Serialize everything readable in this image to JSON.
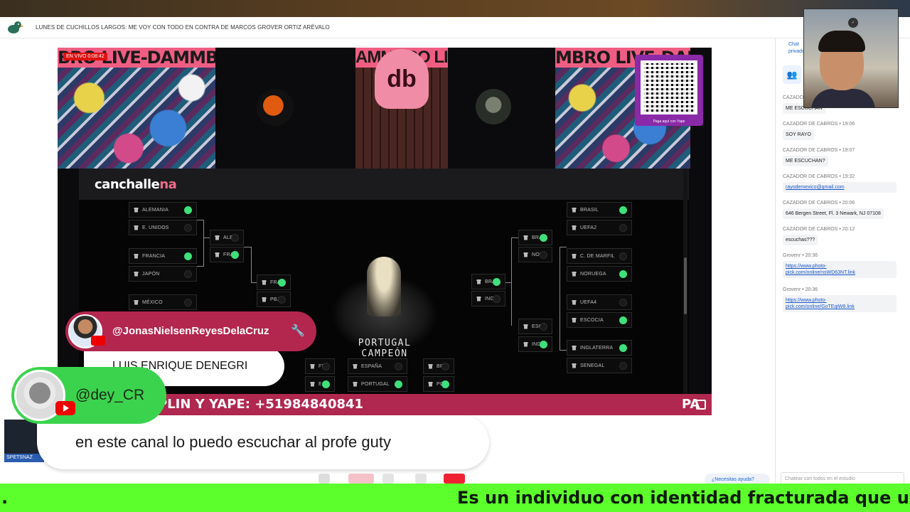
{
  "header": {
    "title": "LUNES DE CUCHILLOS LARGOS: ME VOY CON TODO EN CONTRA DE MARCOS GROVER ORTIZ ARÉVALO"
  },
  "stage": {
    "live_label": "EN VIVO 0:08:42",
    "banner_text": "BRO LIVE-DAMMBRO LIVE",
    "db_logo": "db",
    "banner_right": "MBRO LIVE-DAMMBRO LIVE-",
    "qr_caption": "Paga aquí con Yape",
    "brand_a": "canchalle",
    "brand_b": "na",
    "champion": "PORTUGAL CAMPEÓN",
    "ticker_left": "M, PLIN Y YAPE: +51984840841",
    "ticker_right": "PA"
  },
  "bracket": {
    "left_r1": [
      {
        "name": "ALEMANIA",
        "win": true
      },
      {
        "name": "E. UNIDOS",
        "win": false
      },
      {
        "name": "FRANCIA",
        "win": true
      },
      {
        "name": "JAPÓN",
        "win": false
      },
      {
        "name": "MÉXICO",
        "win": false
      }
    ],
    "left_r2": [
      {
        "name": "ALE",
        "win": false
      },
      {
        "name": "FRA",
        "win": true
      }
    ],
    "left_r3": [
      {
        "name": "FRA",
        "win": true
      },
      {
        "name": "PBJ",
        "win": false
      }
    ],
    "right_r1": [
      {
        "name": "BRASIL",
        "win": true
      },
      {
        "name": "UEFA2",
        "win": false
      },
      {
        "name": "C. DE MARFIL",
        "win": false
      },
      {
        "name": "NORUEGA",
        "win": true
      },
      {
        "name": "UEFA4",
        "win": false
      },
      {
        "name": "ESCOCIA",
        "win": true
      },
      {
        "name": "INGLATERRA",
        "win": true
      },
      {
        "name": "SENEGAL",
        "win": false
      }
    ],
    "right_r2": [
      {
        "name": "BRA",
        "win": true
      },
      {
        "name": "NOR",
        "win": false
      },
      {
        "name": "ESC",
        "win": false
      },
      {
        "name": "ING",
        "win": true
      }
    ],
    "right_r3": [
      {
        "name": "BRA",
        "win": true
      },
      {
        "name": "ING",
        "win": false
      }
    ],
    "bottom": [
      {
        "name": "FRA",
        "win": false
      },
      {
        "name": "ESP",
        "win": true
      },
      {
        "name": "ESPAÑA",
        "win": false
      },
      {
        "name": "PORTUGAL",
        "win": true
      },
      {
        "name": "BRA",
        "win": false
      },
      {
        "name": "POR",
        "win": true
      }
    ]
  },
  "overlay": {
    "comment1_user": "@JonasNielsenReyesDelaCruz",
    "comment1_text": "LUIS ENRIQUE DENEGRI",
    "comment2_user": "@dey_CR",
    "comment2_text": "en este canal lo puedo escuchar al profe guty"
  },
  "side_thumb": {
    "label": "SPETSNAZ"
  },
  "chat": {
    "tab_label": "Chat privado",
    "messages": [
      {
        "meta": "CAZADOR DE CABROS",
        "text": "ME ESCUCHAN",
        "link": false
      },
      {
        "meta": "CAZADOR DE CABROS • 19:06",
        "text": "SOY RAYO",
        "link": false
      },
      {
        "meta": "CAZADOR DE CABROS • 19:07",
        "text": "ME ESCUCHAN?",
        "link": false
      },
      {
        "meta": "CAZADOR DE CABROS • 19:32",
        "text": "rayodemexico@gmail.com",
        "link": true
      },
      {
        "meta": "CAZADOR DE CABROS • 20:06",
        "text": "646 Bergen Street, Fl. 3 Newark, NJ 07108",
        "link": false
      },
      {
        "meta": "CAZADOR DE CABROS • 20:12",
        "text": "escuchas???",
        "link": false
      },
      {
        "meta": "Grovenr • 20:36",
        "text": "https://www.photo-pick.com/online/nsWD63NT.link",
        "link": true
      },
      {
        "meta": "Grovenr • 20:36",
        "text": "https://www.photo-pick.com/online/GoTEqiW8.link",
        "link": true
      }
    ],
    "input_placeholder": "Chatear con todos en el estudio",
    "help_label": "¿Necesitas ayuda?"
  },
  "marquee": {
    "dot": ".",
    "text": "Es un individuo con identidad fracturada que usa el ar"
  },
  "colors": {
    "ticker": "#b02850",
    "marquee": "#5cff2c",
    "win_dot": "#3ee07a"
  }
}
